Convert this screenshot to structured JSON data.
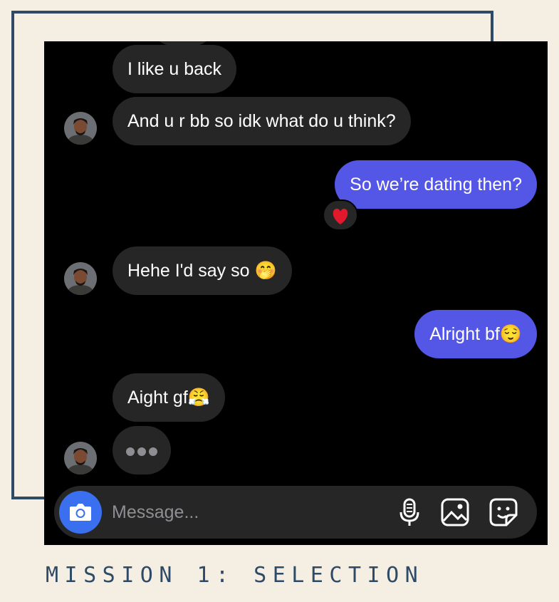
{
  "conversation": {
    "messages": [
      {
        "text": "I like u back",
        "sender": "them"
      },
      {
        "text": "And u r bb so idk what do u think?",
        "sender": "them"
      },
      {
        "text": "So we’re dating then?",
        "sender": "me",
        "reaction": "❤️"
      },
      {
        "text": "Hehe I'd say so",
        "emoji": "🤭",
        "sender": "them"
      },
      {
        "text": "Alright bf",
        "emoji": "😌",
        "sender": "me"
      },
      {
        "text": "Aight gf",
        "emoji": "😤",
        "sender": "them"
      }
    ],
    "typing_indicator": "•••"
  },
  "composer": {
    "placeholder": "Message...",
    "icons": [
      "camera-icon",
      "microphone-icon",
      "gallery-icon",
      "sticker-icon"
    ],
    "accent_color": "#3a6ff0"
  },
  "colors": {
    "incoming_bubble": "#262626",
    "outgoing_bubble": "#5457e6",
    "frame": "#2f4a66",
    "background": "#f4efe2"
  },
  "caption": "MISSION 1: SELECTION"
}
